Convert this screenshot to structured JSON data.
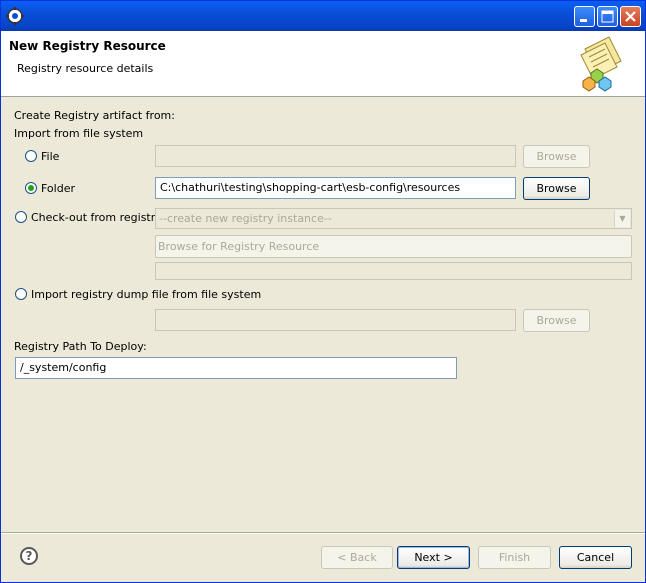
{
  "window": {
    "title": ""
  },
  "banner": {
    "title": "New Registry Resource",
    "subtitle": "Registry resource details"
  },
  "form": {
    "create_label": "Create Registry artifact from:",
    "import_label": "Import from file system",
    "file_label": "File",
    "file_value": "",
    "folder_label": "Folder",
    "folder_value": "C:\\chathuri\\testing\\shopping-cart\\esb-config\\resources",
    "browse_label": "Browse",
    "checkout_label": "Check-out from registry",
    "registry_instance": "--create new registry instance--",
    "browse_registry_label": "Browse for Registry Resource",
    "dump_label": "Import registry dump file from file system",
    "path_label": "Registry Path To Deploy:",
    "path_value": "/_system/config"
  },
  "footer": {
    "back_label": "< Back",
    "next_label": "Next >",
    "finish_label": "Finish",
    "cancel_label": "Cancel"
  },
  "colors": {
    "titlebar": "#0a5ff5",
    "radio_selected": "#21a121",
    "face": "#ece9d8"
  }
}
